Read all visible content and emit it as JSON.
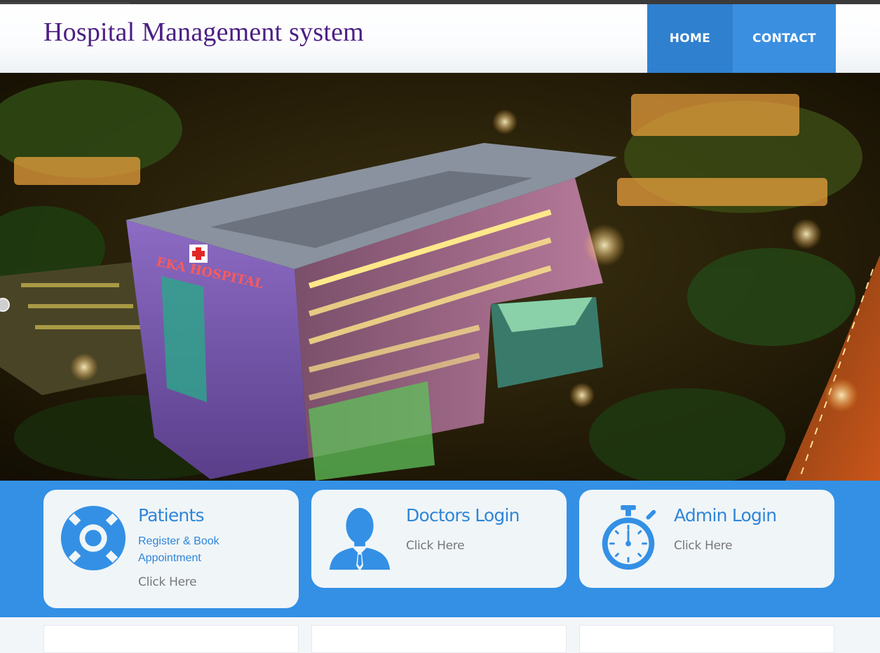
{
  "header": {
    "site_title": "Hospital Management system",
    "nav": [
      {
        "label": "HOME"
      },
      {
        "label": "CONTACT"
      }
    ]
  },
  "hero": {
    "building_sign": "EKA HOSPITAL"
  },
  "cards": [
    {
      "title": "Patients",
      "subtitle": "Register & Book Appointment",
      "link": "Click Here",
      "icon": "lifebuoy-icon"
    },
    {
      "title": "Doctors Login",
      "link": "Click Here",
      "icon": "doctor-icon"
    },
    {
      "title": "Admin Login",
      "link": "Click Here",
      "icon": "stopwatch-icon"
    }
  ],
  "colors": {
    "brand_blue": "#3390e5",
    "nav_home": "#2f80cf",
    "nav_contact": "#3a8fe1",
    "title_purple": "#4b1e83",
    "card_bg": "#f0f5f8"
  }
}
